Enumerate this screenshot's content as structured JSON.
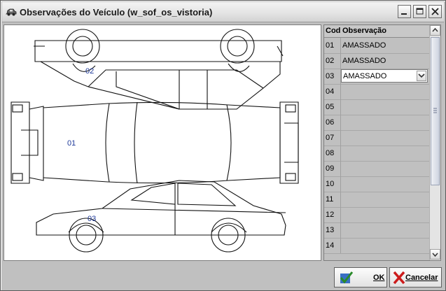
{
  "window": {
    "title": "Observações do Veículo (w_sof_os_vistoria)"
  },
  "diagram": {
    "labels": [
      "01",
      "02",
      "03"
    ]
  },
  "grid": {
    "headers": {
      "cod": "Cod",
      "obs": "Observação"
    },
    "rows": [
      {
        "cod": "01",
        "obs": "AMASSADO"
      },
      {
        "cod": "02",
        "obs": "AMASSADO"
      },
      {
        "cod": "03",
        "obs": "AMASSADO"
      },
      {
        "cod": "04",
        "obs": ""
      },
      {
        "cod": "05",
        "obs": ""
      },
      {
        "cod": "06",
        "obs": ""
      },
      {
        "cod": "07",
        "obs": ""
      },
      {
        "cod": "08",
        "obs": ""
      },
      {
        "cod": "09",
        "obs": ""
      },
      {
        "cod": "10",
        "obs": ""
      },
      {
        "cod": "11",
        "obs": ""
      },
      {
        "cod": "12",
        "obs": ""
      },
      {
        "cod": "13",
        "obs": ""
      },
      {
        "cod": "14",
        "obs": ""
      }
    ],
    "active_row": 2
  },
  "buttons": {
    "ok": "OK",
    "cancel": "Cancelar"
  },
  "icons": {
    "window": "car-icon",
    "ok": "check-icon",
    "cancel": "x-icon"
  },
  "colors": {
    "labels": "#1f3a9a",
    "ok_check": "#2a8a2a",
    "cancel_x": "#cc1b1b"
  }
}
